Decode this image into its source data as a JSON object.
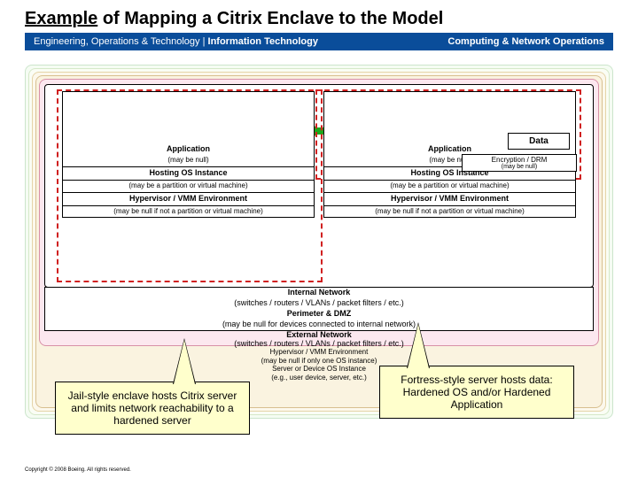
{
  "title_underlined": "Example",
  "title_rest": " of Mapping a Citrix Enclave to the Model",
  "subheader_left_normal": "Engineering, Operations & Technology | ",
  "subheader_left_bold": "Information Technology",
  "subheader_right": "Computing & Network Operations",
  "data_label": "Data",
  "encdrm_label": "Encryption / DRM",
  "encdrm_sub": "(may be null)",
  "left_stack": {
    "app": "Application",
    "app_sub": "(may be null)",
    "hos": "Hosting OS Instance",
    "hos_sub": "(may be a partition or virtual machine)",
    "hyp": "Hypervisor / VMM Environment",
    "hyp_sub": "(may be null if not a partition or virtual machine)"
  },
  "right_stack": {
    "app": "Application",
    "app_sub": "(may be null)",
    "hos": "Hosting OS Instance",
    "hos_sub": "(may be a partition or virtual machine)",
    "hyp": "Hypervisor / VMM Environment",
    "hyp_sub": "(may be null if not a partition or virtual machine)"
  },
  "mid": {
    "intnet": "Internal Network",
    "intnet_sub": "(switches / routers / VLANs / packet filters / etc.)",
    "perim": "Perimeter & DMZ",
    "perim_sub": "(may be null for devices connected to internal network)",
    "extnet": "External Network",
    "extnet_sub": "(switches / routers / VLANs / packet filters / etc.)"
  },
  "low": {
    "l1a": "Hypervisor / VMM Environment",
    "l1b": "(may be null if only one OS instance)",
    "l2a": "Server or Device OS Instance",
    "l2b": "(e.g., user device, server, etc.)"
  },
  "callout_left": "Jail-style enclave hosts Citrix server and limits network reachability to a hardened server",
  "callout_right": "Fortress-style server hosts data: Hardened OS and/or Hardened Application",
  "copyright": "Copyright © 2008 Boeing. All rights reserved."
}
